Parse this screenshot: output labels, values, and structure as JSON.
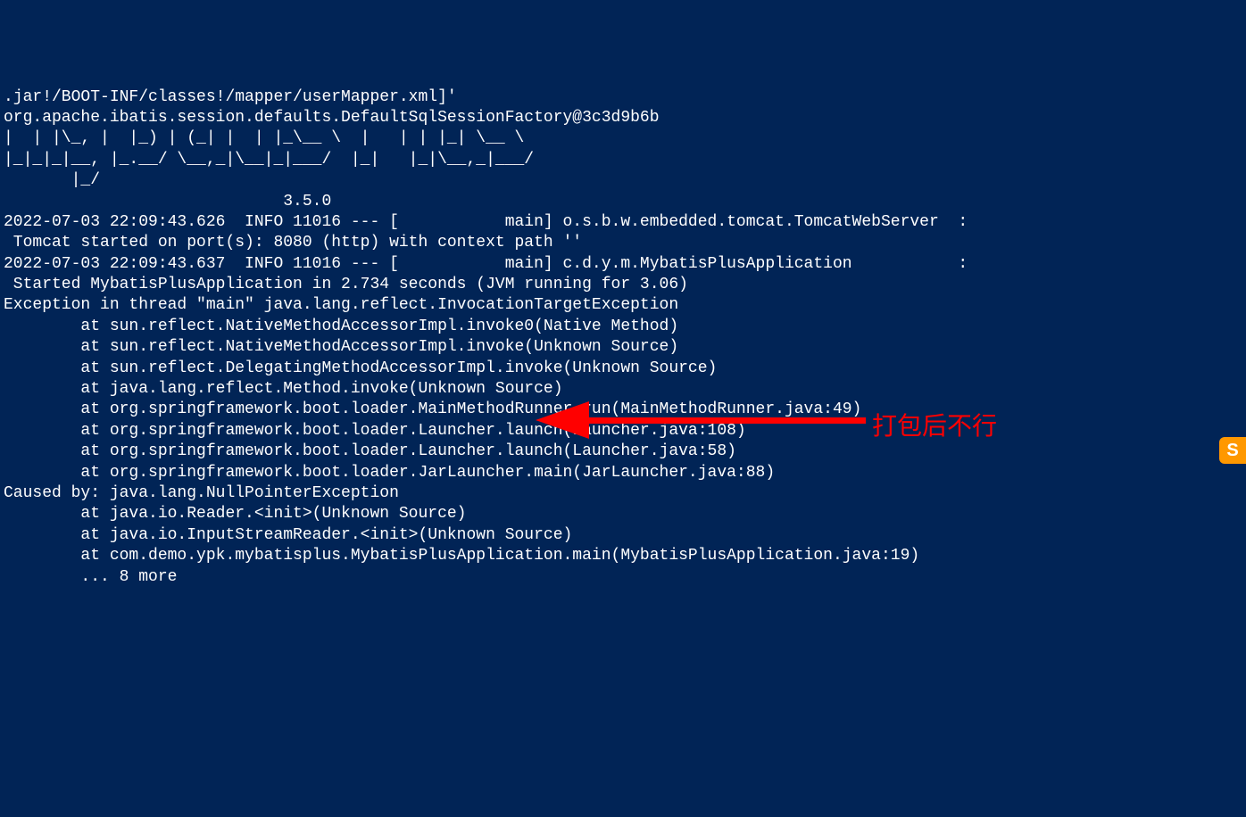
{
  "terminal": {
    "lines": [
      ".jar!/BOOT-INF/classes!/mapper/userMapper.xml]'",
      "org.apache.ibatis.session.defaults.DefaultSqlSessionFactory@3c3d9b6b",
      "|  | |\\_, |  |_) | (_| |  | |_\\__ \\  |   | | |_| \\__ \\",
      "|_|_|_|__, |_.__/ \\__,_|\\__|_|___/  |_|   |_|\\__,_|___/",
      "       |_/                                              ",
      "                             3.5.0",
      "2022-07-03 22:09:43.626  INFO 11016 --- [           main] o.s.b.w.embedded.tomcat.TomcatWebServer  :",
      " Tomcat started on port(s): 8080 (http) with context path ''",
      "2022-07-03 22:09:43.637  INFO 11016 --- [           main] c.d.y.m.MybatisPlusApplication           :",
      " Started MybatisPlusApplication in 2.734 seconds (JVM running for 3.06)",
      "Exception in thread \"main\" java.lang.reflect.InvocationTargetException",
      "        at sun.reflect.NativeMethodAccessorImpl.invoke0(Native Method)",
      "        at sun.reflect.NativeMethodAccessorImpl.invoke(Unknown Source)",
      "        at sun.reflect.DelegatingMethodAccessorImpl.invoke(Unknown Source)",
      "        at java.lang.reflect.Method.invoke(Unknown Source)",
      "        at org.springframework.boot.loader.MainMethodRunner.run(MainMethodRunner.java:49)",
      "        at org.springframework.boot.loader.Launcher.launch(Launcher.java:108)",
      "        at org.springframework.boot.loader.Launcher.launch(Launcher.java:58)",
      "        at org.springframework.boot.loader.JarLauncher.main(JarLauncher.java:88)",
      "Caused by: java.lang.NullPointerException",
      "        at java.io.Reader.<init>(Unknown Source)",
      "        at java.io.InputStreamReader.<init>(Unknown Source)",
      "        at com.demo.ypk.mybatisplus.MybatisPlusApplication.main(MybatisPlusApplication.java:19)",
      "        ... 8 more"
    ],
    "colon_lines": [
      6,
      8
    ]
  },
  "annotation": {
    "text": "打包后不行"
  },
  "icon": {
    "label": "S"
  }
}
